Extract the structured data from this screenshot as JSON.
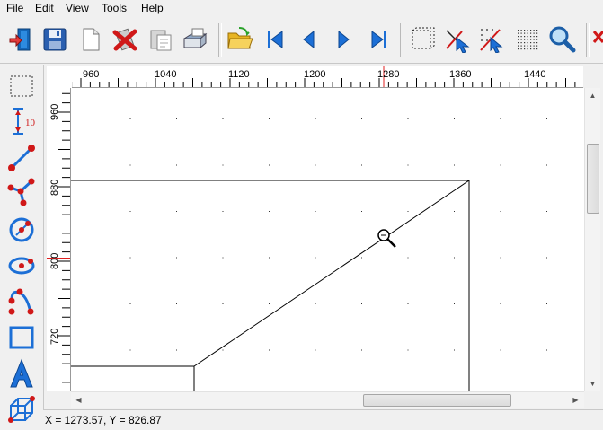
{
  "menu": [
    "File",
    "Edit",
    "View",
    "Tools",
    "Help"
  ],
  "toolbar_icons": [
    "exit-icon",
    "save-icon",
    "new-document-icon",
    "delete-icon",
    "paste-icon",
    "print-icon",
    "open-folder-icon",
    "first-page-icon",
    "previous-page-icon",
    "next-page-icon",
    "last-page-icon",
    "select-frame-icon",
    "select-cursor-icon",
    "snap-line-icon",
    "grid-icon",
    "zoom-icon"
  ],
  "left_tools": [
    "select-rectangle-icon",
    "dimension-icon",
    "line-icon",
    "polyline-icon",
    "circle-icon",
    "ellipse-icon",
    "curve-icon",
    "rectangle-icon",
    "text-icon",
    "box-3d-icon"
  ],
  "dimension_tool_label": "10",
  "ruler_top": {
    "labels": [
      "960",
      "1040",
      "1120",
      "1200",
      "1280",
      "1360",
      "1440"
    ],
    "marker": 1280
  },
  "ruler_left": {
    "labels": [
      "960",
      "880",
      "800",
      "720"
    ],
    "marker": 840
  },
  "status": {
    "coords": "X = 1273.57, Y = 826.87"
  },
  "colors": {
    "accent_blue": "#1c6fd6",
    "tool_red": "#d01818",
    "ruler_marker": "#e02020"
  }
}
